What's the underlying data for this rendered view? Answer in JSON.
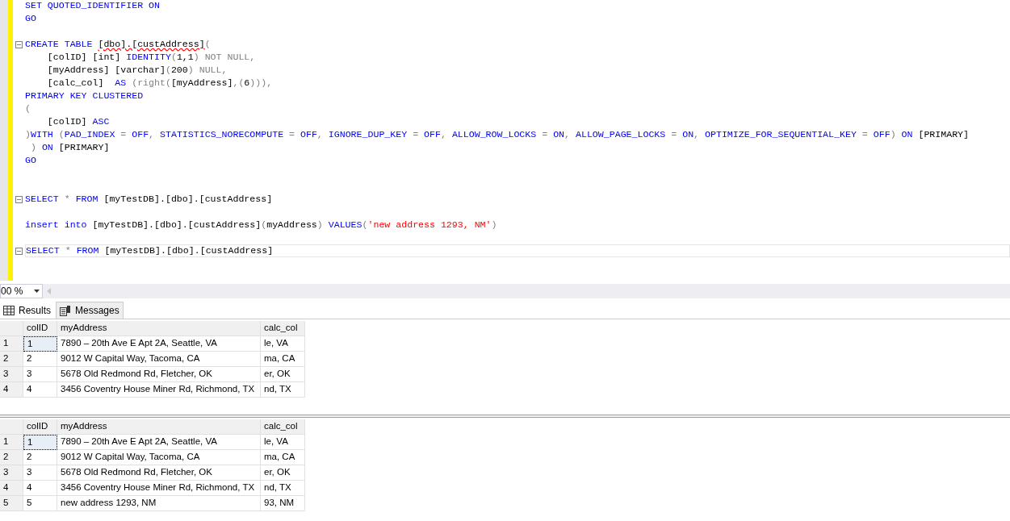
{
  "editor": {
    "lines": [
      {
        "fold": false,
        "current": false,
        "tokens": [
          {
            "kind": "keyword",
            "text": "SET QUOTED_IDENTIFIER ON"
          }
        ]
      },
      {
        "fold": false,
        "current": false,
        "tokens": [
          {
            "kind": "keyword",
            "text": "GO"
          }
        ]
      },
      {
        "fold": false,
        "current": false
      },
      {
        "fold": true,
        "current": false,
        "tokens": [
          {
            "kind": "keyword",
            "text": "CREATE TABLE "
          },
          {
            "kind": "error",
            "text": "[dbo].[custAddress]"
          },
          {
            "kind": "gray",
            "text": "("
          }
        ]
      },
      {
        "fold": false,
        "current": false,
        "tokens": [
          {
            "kind": "plain",
            "text": "    [colID] [int] "
          },
          {
            "kind": "keyword",
            "text": "IDENTITY"
          },
          {
            "kind": "gray",
            "text": "("
          },
          {
            "kind": "plain",
            "text": "1,1"
          },
          {
            "kind": "gray",
            "text": ") NOT NULL,"
          }
        ]
      },
      {
        "fold": false,
        "current": false,
        "tokens": [
          {
            "kind": "plain",
            "text": "    [myAddress] [varchar]"
          },
          {
            "kind": "gray",
            "text": "("
          },
          {
            "kind": "plain",
            "text": "200"
          },
          {
            "kind": "gray",
            "text": ") NULL,"
          }
        ]
      },
      {
        "fold": false,
        "current": false,
        "tokens": [
          {
            "kind": "plain",
            "text": "    [calc_col]  "
          },
          {
            "kind": "keyword",
            "text": "AS "
          },
          {
            "kind": "gray",
            "text": "(right("
          },
          {
            "kind": "plain",
            "text": "[myAddress]"
          },
          {
            "kind": "gray",
            "text": ",("
          },
          {
            "kind": "plain",
            "text": "6"
          },
          {
            "kind": "gray",
            "text": "))),"
          }
        ]
      },
      {
        "fold": false,
        "current": false,
        "tokens": [
          {
            "kind": "keyword",
            "text": "PRIMARY KEY CLUSTERED"
          }
        ]
      },
      {
        "fold": false,
        "current": false,
        "tokens": [
          {
            "kind": "gray",
            "text": "("
          }
        ]
      },
      {
        "fold": false,
        "current": false,
        "tokens": [
          {
            "kind": "plain",
            "text": "    [colID] "
          },
          {
            "kind": "keyword",
            "text": "ASC"
          }
        ]
      },
      {
        "fold": false,
        "current": false,
        "tokens": [
          {
            "kind": "gray",
            "text": ")"
          },
          {
            "kind": "keyword",
            "text": "WITH "
          },
          {
            "kind": "gray",
            "text": "("
          },
          {
            "kind": "keyword",
            "text": "PAD_INDEX "
          },
          {
            "kind": "gray",
            "text": "= "
          },
          {
            "kind": "keyword",
            "text": "OFF"
          },
          {
            "kind": "gray",
            "text": ", "
          },
          {
            "kind": "keyword",
            "text": "STATISTICS_NORECOMPUTE "
          },
          {
            "kind": "gray",
            "text": "= "
          },
          {
            "kind": "keyword",
            "text": "OFF"
          },
          {
            "kind": "gray",
            "text": ", "
          },
          {
            "kind": "keyword",
            "text": "IGNORE_DUP_KEY "
          },
          {
            "kind": "gray",
            "text": "= "
          },
          {
            "kind": "keyword",
            "text": "OFF"
          },
          {
            "kind": "gray",
            "text": ", "
          },
          {
            "kind": "keyword",
            "text": "ALLOW_ROW_LOCKS "
          },
          {
            "kind": "gray",
            "text": "= "
          },
          {
            "kind": "keyword",
            "text": "ON"
          },
          {
            "kind": "gray",
            "text": ", "
          },
          {
            "kind": "keyword",
            "text": "ALLOW_PAGE_LOCKS "
          },
          {
            "kind": "gray",
            "text": "= "
          },
          {
            "kind": "keyword",
            "text": "ON"
          },
          {
            "kind": "gray",
            "text": ", "
          },
          {
            "kind": "keyword",
            "text": "OPTIMIZE_FOR_SEQUENTIAL_KEY "
          },
          {
            "kind": "gray",
            "text": "= "
          },
          {
            "kind": "keyword",
            "text": "OFF"
          },
          {
            "kind": "gray",
            "text": ") "
          },
          {
            "kind": "keyword",
            "text": "ON "
          },
          {
            "kind": "plain",
            "text": "[PRIMARY]"
          }
        ]
      },
      {
        "fold": false,
        "current": false,
        "tokens": [
          {
            "kind": "gray",
            "text": " ) "
          },
          {
            "kind": "keyword",
            "text": "ON "
          },
          {
            "kind": "plain",
            "text": "[PRIMARY]"
          }
        ]
      },
      {
        "fold": false,
        "current": false,
        "tokens": [
          {
            "kind": "keyword",
            "text": "GO"
          }
        ]
      },
      {
        "fold": false,
        "current": false
      },
      {
        "fold": false,
        "current": false
      },
      {
        "fold": true,
        "current": false,
        "tokens": [
          {
            "kind": "keyword",
            "text": "SELECT "
          },
          {
            "kind": "gray",
            "text": "* "
          },
          {
            "kind": "keyword",
            "text": "FROM "
          },
          {
            "kind": "plain",
            "text": "[myTestDB].[dbo].[custAddress]"
          }
        ]
      },
      {
        "fold": false,
        "current": false
      },
      {
        "fold": false,
        "current": false,
        "tokens": [
          {
            "kind": "keyword",
            "text": "insert into "
          },
          {
            "kind": "plain",
            "text": "[myTestDB].[dbo].[custAddress]"
          },
          {
            "kind": "gray",
            "text": "("
          },
          {
            "kind": "plain",
            "text": "myAddress"
          },
          {
            "kind": "gray",
            "text": ") "
          },
          {
            "kind": "keyword",
            "text": "VALUES"
          },
          {
            "kind": "gray",
            "text": "("
          },
          {
            "kind": "string",
            "text": "'new address 1293, NM'"
          },
          {
            "kind": "gray",
            "text": ")"
          }
        ]
      },
      {
        "fold": false,
        "current": false
      },
      {
        "fold": true,
        "current": true,
        "tokens": [
          {
            "kind": "keyword",
            "text": "SELECT "
          },
          {
            "kind": "gray",
            "text": "* "
          },
          {
            "kind": "keyword",
            "text": "FROM "
          },
          {
            "kind": "plain",
            "text": "[myTestDB].[dbo].[custAddress]"
          }
        ]
      }
    ]
  },
  "zoom": {
    "value": "00 %"
  },
  "tabs": [
    {
      "label": "Results",
      "kind": "grid",
      "selected": true
    },
    {
      "label": "Messages",
      "kind": "messages",
      "selected": false
    }
  ],
  "grids": [
    {
      "columns": [
        "colID",
        "myAddress",
        "calc_col"
      ],
      "rows": [
        {
          "number": "1",
          "focused": true,
          "cells": [
            "1",
            "7890 – 20th Ave E Apt 2A, Seattle, VA",
            "le, VA"
          ]
        },
        {
          "number": "2",
          "focused": false,
          "cells": [
            "2",
            "9012 W Capital Way, Tacoma, CA",
            "ma, CA"
          ]
        },
        {
          "number": "3",
          "focused": false,
          "cells": [
            "3",
            "5678 Old Redmond Rd, Fletcher, OK",
            "er, OK"
          ]
        },
        {
          "number": "4",
          "focused": false,
          "cells": [
            "4",
            "3456 Coventry House Miner Rd, Richmond, TX",
            "nd, TX"
          ]
        }
      ]
    },
    {
      "columns": [
        "colID",
        "myAddress",
        "calc_col"
      ],
      "rows": [
        {
          "number": "1",
          "focused": true,
          "cells": [
            "1",
            "7890 – 20th Ave E Apt 2A, Seattle, VA",
            "le, VA"
          ]
        },
        {
          "number": "2",
          "focused": false,
          "cells": [
            "2",
            "9012 W Capital Way, Tacoma, CA",
            "ma, CA"
          ]
        },
        {
          "number": "3",
          "focused": false,
          "cells": [
            "3",
            "5678 Old Redmond Rd, Fletcher, OK",
            "er, OK"
          ]
        },
        {
          "number": "4",
          "focused": false,
          "cells": [
            "4",
            "3456 Coventry House Miner Rd, Richmond, TX",
            "nd, TX"
          ]
        },
        {
          "number": "5",
          "focused": false,
          "cells": [
            "5",
            "new address 1293, NM",
            "93, NM"
          ]
        }
      ]
    }
  ]
}
